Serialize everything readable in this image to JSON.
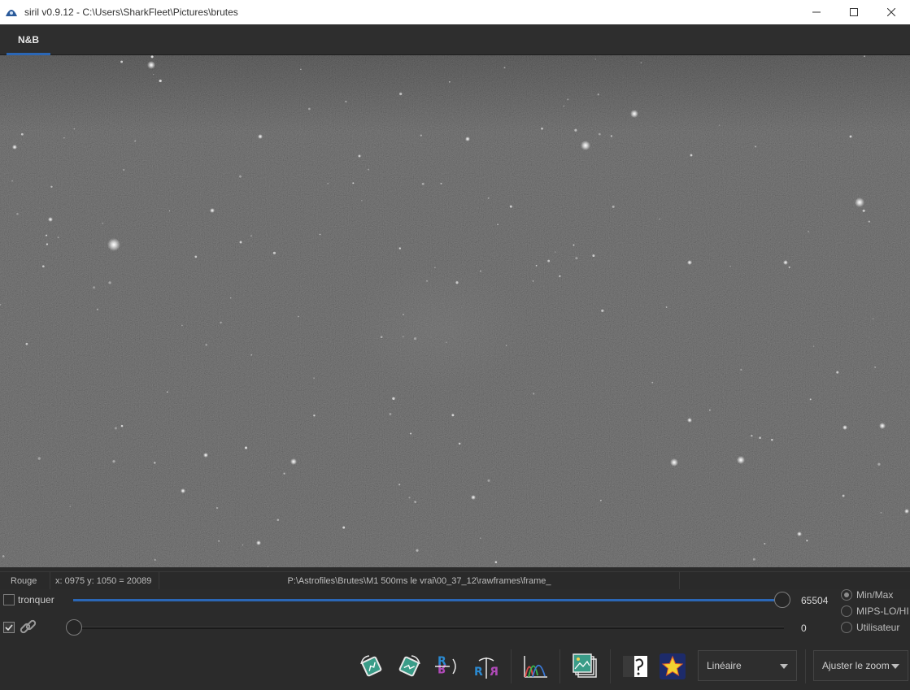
{
  "window": {
    "title": "siril v0.9.12 - C:\\Users\\SharkFleet\\Pictures\\brutes",
    "controls": [
      "minimize-icon",
      "maximize-icon",
      "close-icon"
    ]
  },
  "tabs": [
    {
      "label": "N&B",
      "active": true
    }
  ],
  "status": {
    "channel": "Rouge",
    "coords": "x: 0975 y: 1050 = 20089",
    "path": "P:\\Astrofiles\\Brutes\\M1 500ms le vrai\\00_37_12\\rawframes\\frame_"
  },
  "sliders": {
    "high": {
      "label": "tronquer",
      "checked": false,
      "value": "65504",
      "fraction": 0.999
    },
    "low": {
      "checked": true,
      "link_icon": "link-icon",
      "value": "0",
      "fraction": 0.0
    }
  },
  "scale_modes": [
    {
      "label": "Min/Max",
      "selected": true
    },
    {
      "label": "MIPS-LO/HI",
      "selected": false
    },
    {
      "label": "Utilisateur",
      "selected": false
    }
  ],
  "toolbar": {
    "tools": [
      "rotate-left-icon",
      "rotate-right-icon",
      "mirror-x-icon",
      "mirror-y-icon",
      "histogram-icon",
      "image-stack-icon",
      "photometry-icon",
      "star-icon"
    ],
    "display_mode": "Linéaire",
    "zoom": "Ajuster le zoom"
  },
  "colors": {
    "accent": "#2b67b6",
    "background": "#2b2b2b",
    "sky": "#464646"
  }
}
